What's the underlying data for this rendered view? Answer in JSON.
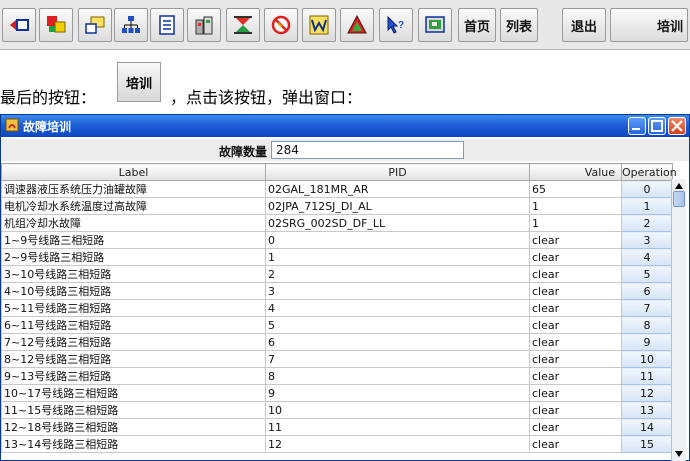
{
  "toolbar": {
    "icon_buttons": [
      {
        "icon": "back-arrow-icon"
      },
      {
        "icon": "color-blocks-icon"
      },
      {
        "icon": "windows-icon"
      },
      {
        "icon": "network-tree-icon"
      },
      {
        "icon": "document-icon"
      },
      {
        "icon": "building-icon"
      },
      {
        "icon": "hourglass-icon"
      },
      {
        "icon": "no-entry-icon"
      },
      {
        "icon": "w-chart-icon"
      },
      {
        "icon": "warning-triangle-icon"
      },
      {
        "icon": "help-cursor-icon"
      },
      {
        "icon": "screen-icon"
      }
    ],
    "text_buttons": [
      "首页",
      "列表",
      "退出",
      "培训"
    ]
  },
  "caption": {
    "before": "最后的按钮：",
    "button_label": "培训",
    "after": "，点击该按钮，弹出窗口："
  },
  "window": {
    "title": "故障培训",
    "fault_count_label": "故障数量",
    "fault_count_value": "284",
    "colors": {
      "title_bar": "#1f5fd6",
      "close_button": "#d4401a"
    }
  },
  "table": {
    "columns": [
      "Label",
      "PID",
      "Value",
      "Operation"
    ],
    "rows": [
      {
        "label": "调速器液压系统压力油罐故障",
        "pid": "02GAL_181MR_AR",
        "value": "65",
        "op": "0"
      },
      {
        "label": "电机冷却水系统温度过高故障",
        "pid": "02JPA_712SJ_DI_AL",
        "value": "1",
        "op": "1"
      },
      {
        "label": "机组冷却水故障",
        "pid": "02SRG_002SD_DF_LL",
        "value": "1",
        "op": "2"
      },
      {
        "label": "1~9号线路三相短路",
        "pid": "0",
        "value": "clear",
        "op": "3"
      },
      {
        "label": "2~9号线路三相短路",
        "pid": "1",
        "value": "clear",
        "op": "4"
      },
      {
        "label": "3~10号线路三相短路",
        "pid": "2",
        "value": "clear",
        "op": "5"
      },
      {
        "label": "4~10号线路三相短路",
        "pid": "3",
        "value": "clear",
        "op": "6"
      },
      {
        "label": "5~11号线路三相短路",
        "pid": "4",
        "value": "clear",
        "op": "7"
      },
      {
        "label": "6~11号线路三相短路",
        "pid": "5",
        "value": "clear",
        "op": "8"
      },
      {
        "label": "7~12号线路三相短路",
        "pid": "6",
        "value": "clear",
        "op": "9"
      },
      {
        "label": "8~12号线路三相短路",
        "pid": "7",
        "value": "clear",
        "op": "10"
      },
      {
        "label": "9~13号线路三相短路",
        "pid": "8",
        "value": "clear",
        "op": "11"
      },
      {
        "label": "10~17号线路三相短路",
        "pid": "9",
        "value": "clear",
        "op": "12"
      },
      {
        "label": "11~15号线路三相短路",
        "pid": "10",
        "value": "clear",
        "op": "13"
      },
      {
        "label": "12~18号线路三相短路",
        "pid": "11",
        "value": "clear",
        "op": "14"
      },
      {
        "label": "13~14号线路三相短路",
        "pid": "12",
        "value": "clear",
        "op": "15"
      }
    ]
  }
}
